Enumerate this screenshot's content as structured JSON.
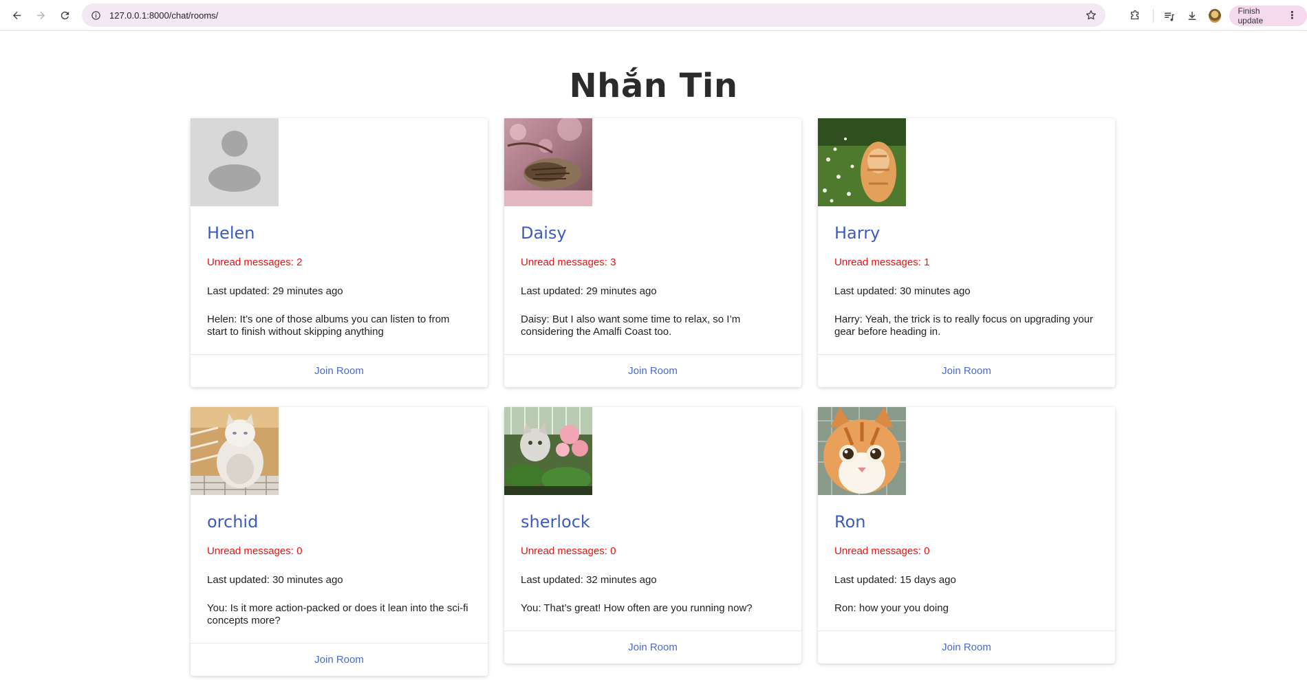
{
  "browser": {
    "url": "127.0.0.1:8000/chat/rooms/",
    "finish_update": "Finish update"
  },
  "page": {
    "title": "Nhắn Tin"
  },
  "rooms": [
    {
      "name": "Helen",
      "unread": "Unread messages: 2",
      "updated": "Last updated: 29 minutes ago",
      "preview": "Helen: It’s one of those albums you can listen to from start to finish without skipping anything",
      "join": "Join Room",
      "avatar": "default-avatar"
    },
    {
      "name": "Daisy",
      "unread": "Unread messages: 3",
      "updated": "Last updated: 29 minutes ago",
      "preview": "Daisy: But I also want some time to relax, so I’m considering the Amalfi Coast too.",
      "join": "Join Room",
      "avatar": "tabby-cat-cherry-blossoms"
    },
    {
      "name": "Harry",
      "unread": "Unread messages: 1",
      "updated": "Last updated: 30 minutes ago",
      "preview": "Harry: Yeah, the trick is to really focus on upgrading your gear before heading in.",
      "join": "Join Room",
      "avatar": "orange-cat-grass-flowers"
    },
    {
      "name": "orchid",
      "unread": "Unread messages: 0",
      "updated": "Last updated: 30 minutes ago",
      "preview": "You: Is it more action-packed or does it lean into the sci-fi concepts more?",
      "join": "Join Room",
      "avatar": "fluffy-white-cat"
    },
    {
      "name": "sherlock",
      "unread": "Unread messages: 0",
      "updated": "Last updated: 32 minutes ago",
      "preview": "You: That’s great! How often are you running now?",
      "join": "Join Room",
      "avatar": "cat-with-pink-flowers"
    },
    {
      "name": "Ron",
      "unread": "Unread messages: 0",
      "updated": "Last updated: 15 days ago",
      "preview": "Ron: how your you doing",
      "join": "Join Room",
      "avatar": "surprised-orange-cat"
    }
  ]
}
